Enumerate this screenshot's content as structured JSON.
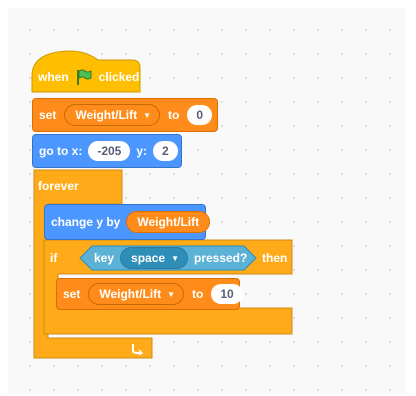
{
  "script": {
    "hat": {
      "label_before": "when",
      "flag_icon": "green-flag-icon",
      "label_after": "clicked"
    },
    "set_top": {
      "label": "set",
      "variable": "Weight/Lift",
      "to_label": "to",
      "value": "0"
    },
    "goto": {
      "label": "go to x:",
      "x_value": "-205",
      "y_label": "y:",
      "y_value": "2"
    },
    "forever": {
      "label": "forever",
      "loop_icon": "loop-arrow-icon"
    },
    "change_y": {
      "label": "change y by",
      "reporter": "Weight/Lift"
    },
    "if_block": {
      "label": "if",
      "condition": {
        "key_label": "key",
        "key_value": "space",
        "pressed_label": "pressed?"
      },
      "then_label": "then"
    },
    "set_inner": {
      "label": "set",
      "variable": "Weight/Lift",
      "to_label": "to",
      "value": "10"
    }
  },
  "colors": {
    "events": "#ffbf00",
    "variables": "#ff8c1a",
    "motion": "#4c97ff",
    "control": "#ffab19",
    "sensing": "#5cb1d6"
  }
}
